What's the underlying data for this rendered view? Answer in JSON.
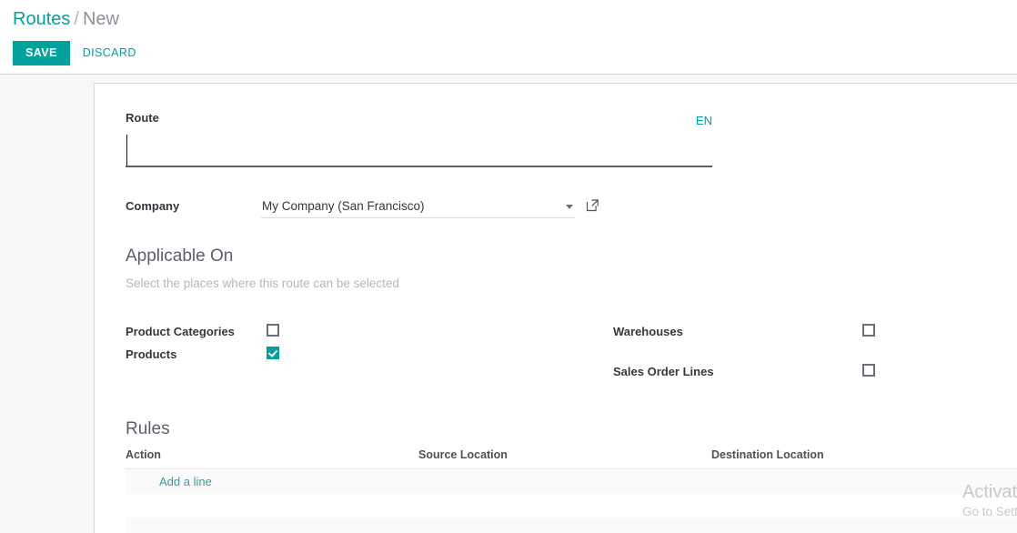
{
  "breadcrumb": {
    "parent": "Routes",
    "separator": "/",
    "current": "New"
  },
  "control_panel": {
    "save_label": "SAVE",
    "discard_label": "DISCARD"
  },
  "form": {
    "route": {
      "label": "Route",
      "value": "",
      "placeholder": "",
      "lang_badge": "EN"
    },
    "company": {
      "label": "Company",
      "value": "My Company (San Francisco)",
      "dropdown_icon": "chevron-down-icon",
      "external_link_icon": "external-link-icon"
    },
    "applicable_on": {
      "title": "Applicable On",
      "subtitle": "Select the places where this route can be selected",
      "left_options": [
        {
          "label": "Product Categories",
          "checked": false
        },
        {
          "label": "Products",
          "checked": true
        }
      ],
      "right_options": [
        {
          "label": "Warehouses",
          "checked": false
        },
        {
          "label": "Sales Order Lines",
          "checked": false
        }
      ]
    },
    "rules": {
      "title": "Rules",
      "columns": [
        "Action",
        "Source Location",
        "Destination Location"
      ],
      "rows": [],
      "add_line_label": "Add a line"
    }
  },
  "watermark": {
    "line1": "Activate Windows",
    "line2": "Go to Settings to activate Windows."
  },
  "colors": {
    "accent": "#00a09d",
    "accent_link": "#3f9b94",
    "text_dark": "#32383e",
    "text_muted": "#8d9298",
    "heading": "#5b6069",
    "sheet_border": "#d8dadd",
    "backdrop": "#f7f7f7",
    "row_zebra": "#fafafa",
    "watermark": "#c6c9cc"
  }
}
